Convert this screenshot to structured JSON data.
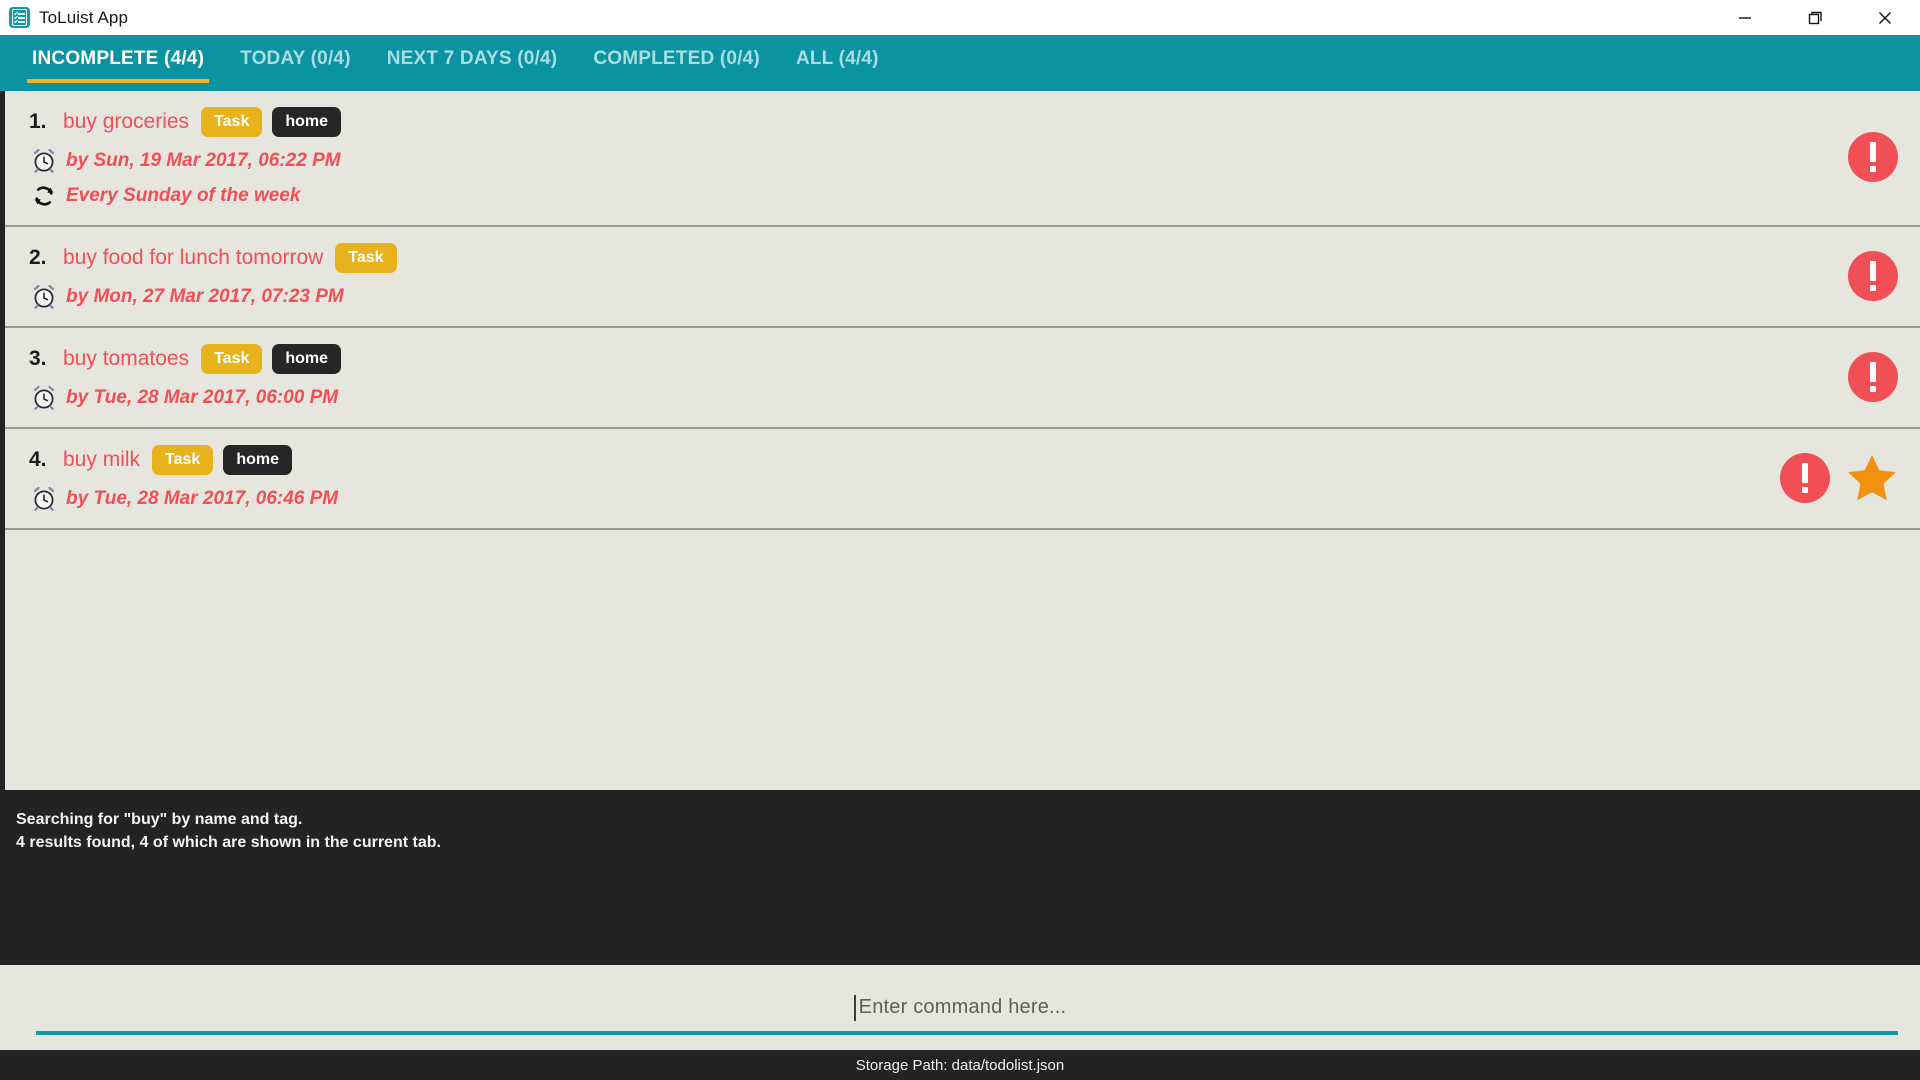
{
  "window": {
    "title": "ToLuist App",
    "app_icon": "checklist-icon",
    "controls": {
      "minimize": "minimize-icon",
      "restore": "restore-icon",
      "close": "close-icon"
    }
  },
  "colors": {
    "teal": "#0b93a2",
    "accent_yellow": "#f0b429",
    "task_red": "#ef4f55",
    "badge_type": "#e8b21c",
    "badge_tag": "#262626",
    "list_bg": "#e6e6de",
    "dark_panel": "#232323",
    "star_orange": "#f0920f"
  },
  "tabs": [
    {
      "label": "INCOMPLETE (4/4)",
      "active": true
    },
    {
      "label": "TODAY (0/4)",
      "active": false
    },
    {
      "label": "NEXT 7 DAYS (0/4)",
      "active": false
    },
    {
      "label": "COMPLETED (0/4)",
      "active": false
    },
    {
      "label": "ALL (4/4)",
      "active": false
    }
  ],
  "tasks": [
    {
      "index": "1.",
      "title": "buy groceries",
      "badges": [
        {
          "text": "Task",
          "kind": "type"
        },
        {
          "text": "home",
          "kind": "tag"
        }
      ],
      "due": "by Sun, 19 Mar 2017, 06:22 PM",
      "recurrence": "Every Sunday of the week",
      "has_priority": true,
      "has_star": false
    },
    {
      "index": "2.",
      "title": "buy food for lunch tomorrow",
      "badges": [
        {
          "text": "Task",
          "kind": "type"
        }
      ],
      "due": "by Mon, 27 Mar 2017, 07:23 PM",
      "recurrence": null,
      "has_priority": true,
      "has_star": false
    },
    {
      "index": "3.",
      "title": "buy tomatoes",
      "badges": [
        {
          "text": "Task",
          "kind": "type"
        },
        {
          "text": "home",
          "kind": "tag"
        }
      ],
      "due": "by Tue, 28 Mar 2017, 06:00 PM",
      "recurrence": null,
      "has_priority": true,
      "has_star": false
    },
    {
      "index": "4.",
      "title": "buy milk",
      "badges": [
        {
          "text": "Task",
          "kind": "type"
        },
        {
          "text": "home",
          "kind": "tag"
        }
      ],
      "due": "by Tue, 28 Mar 2017, 06:46 PM",
      "recurrence": null,
      "has_priority": true,
      "has_star": true
    }
  ],
  "status": {
    "line1": "Searching for \"buy\" by name and tag.",
    "line2": "4 results found, 4 of which are shown in the current tab."
  },
  "command": {
    "value": "",
    "placeholder": "Enter command here..."
  },
  "footer": {
    "storage_path": "Storage Path: data/todolist.json"
  }
}
